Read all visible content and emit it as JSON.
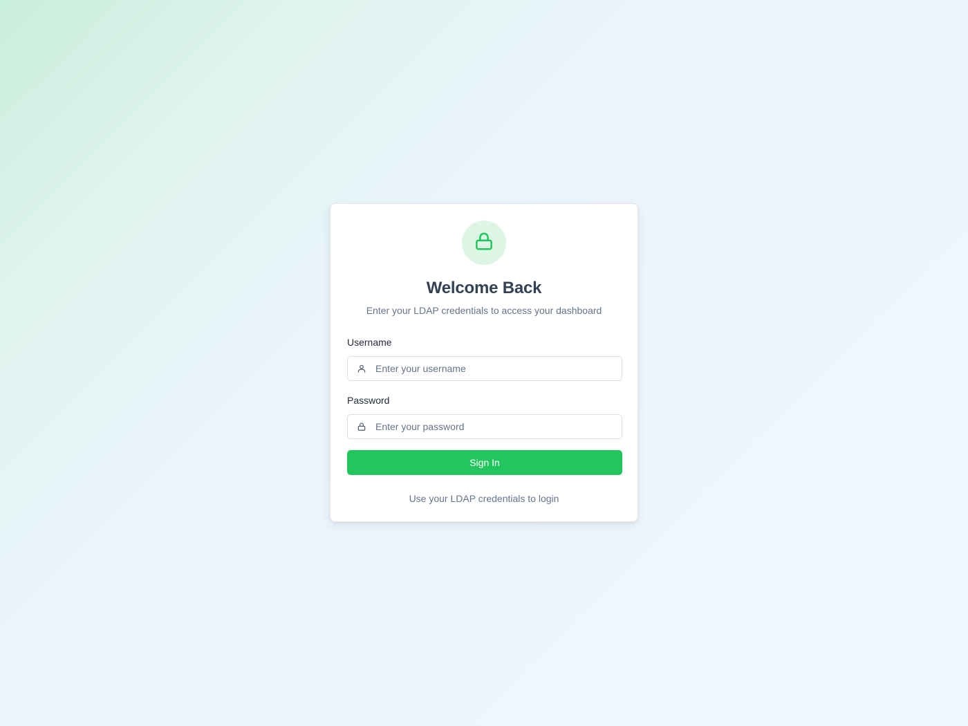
{
  "login": {
    "title": "Welcome Back",
    "subtitle": "Enter your LDAP credentials to access your dashboard",
    "username": {
      "label": "Username",
      "placeholder": "Enter your username",
      "value": "",
      "icon": "user-icon"
    },
    "password": {
      "label": "Password",
      "placeholder": "Enter your password",
      "value": "",
      "icon": "lock-icon"
    },
    "submit_label": "Sign In",
    "footer_note": "Use your LDAP credentials to login",
    "header_icon": "lock-icon"
  },
  "colors": {
    "accent": "#22c55e",
    "accent_soft": "#dcf5e5",
    "title": "#334155",
    "muted": "#64748b"
  }
}
